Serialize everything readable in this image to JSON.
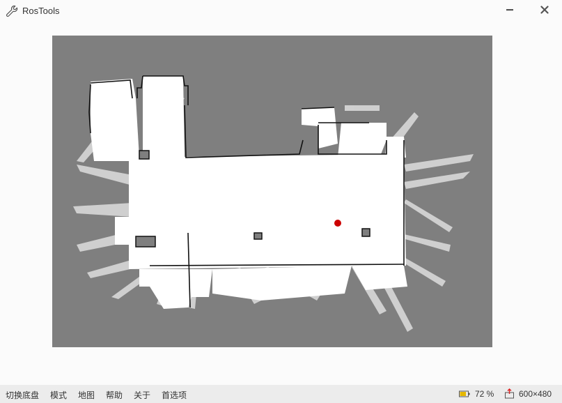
{
  "window": {
    "title": "RosTools",
    "app_icon": "wrench-icon",
    "minimize_icon": "minimize-icon",
    "close_icon": "close-icon"
  },
  "map": {
    "robot_color": "#cc0000",
    "free_color": "#ffffff",
    "unknown_color": "#7f7f7f",
    "wall_color": "#111111"
  },
  "menu": {
    "items": [
      {
        "label": "切换底盘"
      },
      {
        "label": "模式"
      },
      {
        "label": "地图"
      },
      {
        "label": "帮助"
      },
      {
        "label": "关于"
      },
      {
        "label": "首选项"
      }
    ]
  },
  "status": {
    "battery_icon": "battery-icon",
    "battery_text": "72 %",
    "battery_level": 0.72,
    "resolution_icon": "resolution-icon",
    "resolution_text": "600×480"
  }
}
